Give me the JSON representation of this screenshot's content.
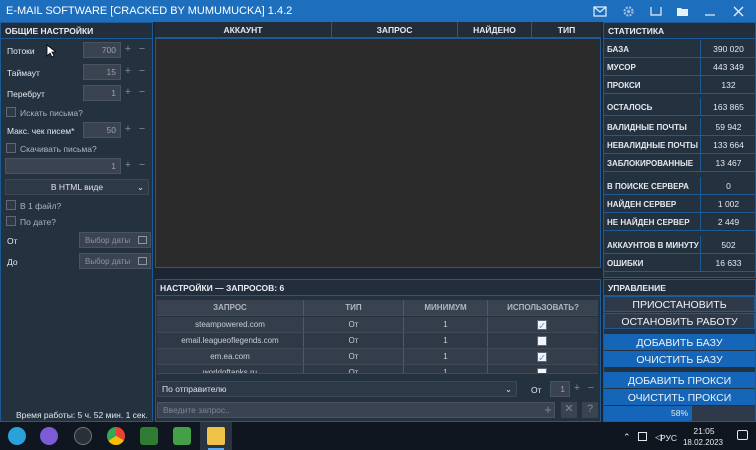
{
  "window": {
    "title": "E-MAIL SOFTWARE [CRACKED BY MUMUMUCKA] 1.4.2",
    "icons": [
      "mail-check-icon",
      "gear-icon",
      "minimize-icon",
      "folder-icon",
      "close-icon"
    ]
  },
  "settings": {
    "header": "ОБЩИЕ НАСТРОЙКИ",
    "threads_label": "Потоки",
    "threads_value": "700",
    "timeout_label": "Таймаут",
    "timeout_value": "15",
    "brute_label": "Перебрут",
    "brute_value": "1",
    "search_letters_label": "Искать письма?",
    "max_check_label": "Макс. чек писем*",
    "max_check_value": "50",
    "download_letters_label": "Скачивать письма?",
    "download_value": "1",
    "format_select": "В HTML виде",
    "one_file_label": "В 1 файл?",
    "by_date_label": "По дате?",
    "from_label": "От",
    "to_label": "До",
    "date_placeholder": "Выбор даты",
    "uptime": "Время работы: 5 ч. 52 мин. 1 сек."
  },
  "log": {
    "columns": [
      "АККАУНТ",
      "ЗАПРОС",
      "НАЙДЕНО",
      "ТИП"
    ]
  },
  "queries": {
    "header": "НАСТРОЙКИ — ЗАПРОСОВ: 6",
    "columns": [
      "ЗАПРОС",
      "ТИП",
      "МИНИМУМ",
      "ИСПОЛЬЗОВАТЬ?"
    ],
    "rows": [
      {
        "query": "steampowered.com",
        "type": "От",
        "min": "1",
        "use": true
      },
      {
        "query": "email.leagueoflegends.com",
        "type": "От",
        "min": "1",
        "use": false
      },
      {
        "query": "em.ea.com",
        "type": "От",
        "min": "1",
        "use": true
      },
      {
        "query": "worldoftanks.ru",
        "type": "От",
        "min": "1",
        "use": false
      }
    ],
    "sender_select": "По отправителю",
    "type_label": "От",
    "min_value": "1",
    "input_placeholder": "Введите запрос..",
    "help": "?"
  },
  "stats": {
    "header": "СТАТИСТИКА",
    "rows": [
      {
        "k": "БАЗА",
        "v": "390 020"
      },
      {
        "k": "МУСОР",
        "v": "443 349"
      },
      {
        "k": "ПРОКСИ",
        "v": "132"
      },
      {
        "k": "ОСТАЛОСЬ",
        "v": "163 865"
      },
      {
        "k": "ВАЛИДНЫЕ ПОЧТЫ",
        "v": "59 942"
      },
      {
        "k": "НЕВАЛИДНЫЕ ПОЧТЫ",
        "v": "133 664"
      },
      {
        "k": "ЗАБЛОКИРОВАННЫЕ",
        "v": "13 467"
      },
      {
        "k": "В ПОИСКЕ СЕРВЕРА",
        "v": "0"
      },
      {
        "k": "НАЙДЕН СЕРВЕР",
        "v": "1 002"
      },
      {
        "k": "НЕ НАЙДЕН СЕРВЕР",
        "v": "2 449"
      },
      {
        "k": "АККАУНТОВ В МИНУТУ",
        "v": "502"
      },
      {
        "k": "ОШИБКИ",
        "v": "16 633"
      }
    ]
  },
  "control": {
    "header": "УПРАВЛЕНИЕ",
    "pause": "ПРИОСТАНОВИТЬ",
    "stop": "ОСТАНОВИТЬ РАБОТУ",
    "add_base": "ДОБАВИТЬ БАЗУ",
    "clear_base": "ОЧИСТИТЬ БАЗУ",
    "add_proxy": "ДОБАВИТЬ ПРОКСИ",
    "clear_proxy": "ОЧИСТИТЬ ПРОКСИ",
    "progress_text": "58%",
    "progress": 0.58
  },
  "taskbar": {
    "lang": "РУС",
    "time": "21:05",
    "date": "18.02.2023"
  }
}
